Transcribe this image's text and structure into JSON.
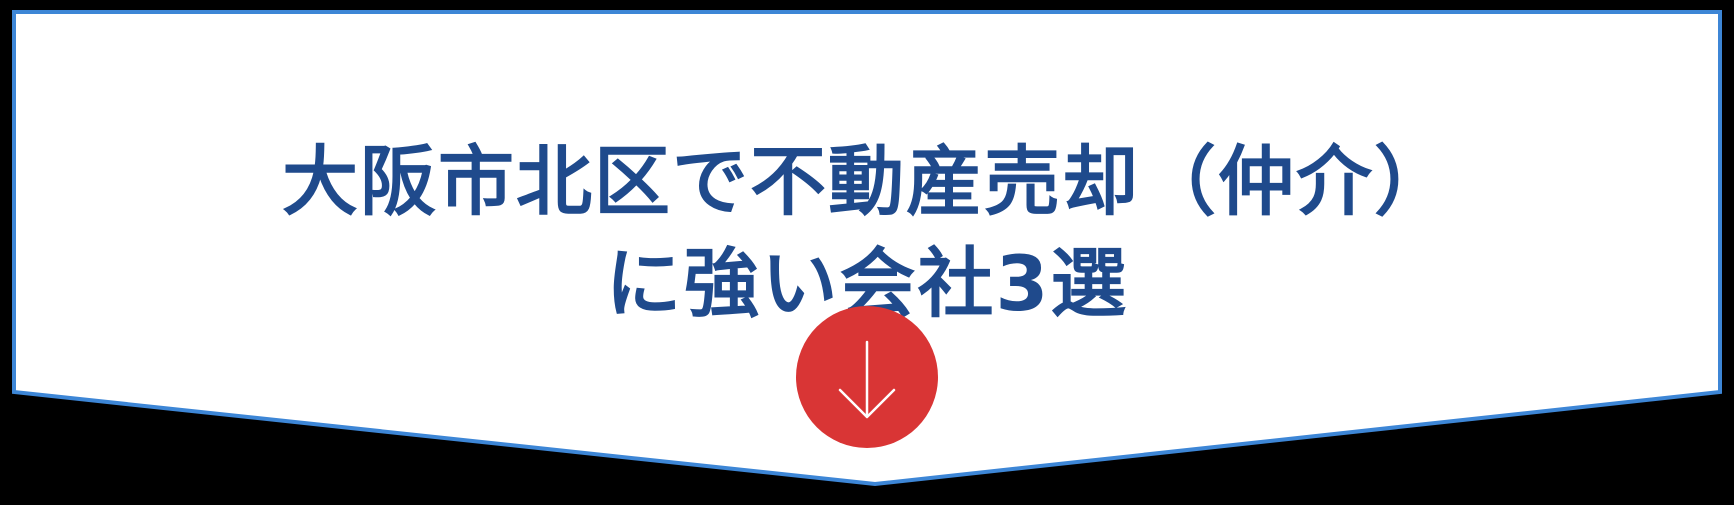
{
  "banner": {
    "title_line1": "大阪市北区で不動産売却（仲介）",
    "title_line2": "に強い会社3選",
    "scroll_icon": "arrow-down-icon",
    "colors": {
      "background": "#000000",
      "panel_fill": "#ffffff",
      "panel_border": "#3d86d6",
      "title_text": "#1f4a8c",
      "button_fill": "#d93535",
      "arrow_stroke": "#ffffff"
    }
  }
}
